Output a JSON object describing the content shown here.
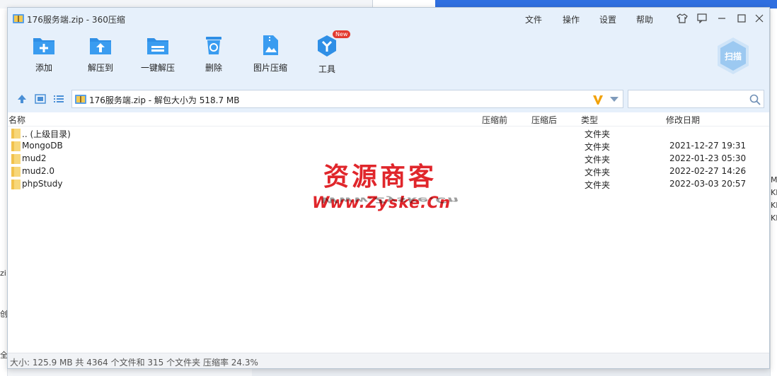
{
  "window": {
    "title": "176服务端.zip - 360压缩",
    "menu": [
      "文件",
      "操作",
      "设置",
      "帮助"
    ]
  },
  "toolbar": {
    "tools": [
      {
        "label": "添加",
        "icon": "add-icon"
      },
      {
        "label": "解压到",
        "icon": "extract-to-icon"
      },
      {
        "label": "一键解压",
        "icon": "one-click-extract-icon"
      },
      {
        "label": "删除",
        "icon": "delete-icon"
      },
      {
        "label": "图片压缩",
        "icon": "image-compress-icon"
      },
      {
        "label": "工具",
        "icon": "tools-icon"
      }
    ],
    "new_badge": "New",
    "scan_label": "扫描"
  },
  "nav": {
    "path": "176服务端.zip - 解包大小为 518.7 MB",
    "search_placeholder": ""
  },
  "list": {
    "columns": [
      "名称",
      "压缩前",
      "压缩后",
      "类型",
      "修改日期"
    ],
    "rows": [
      {
        "name": ".. (上级目录)",
        "type": "文件夹",
        "date": ""
      },
      {
        "name": "MongoDB",
        "type": "文件夹",
        "date": "2021-12-27 19:31"
      },
      {
        "name": "mud2",
        "type": "文件夹",
        "date": "2022-01-23 05:30"
      },
      {
        "name": "mud2.0",
        "type": "文件夹",
        "date": "2022-02-27 14:26"
      },
      {
        "name": "phpStudy",
        "type": "文件夹",
        "date": "2022-03-03 20:57"
      }
    ]
  },
  "watermark": {
    "cn": "资源商客",
    "en": "Www.Zyske.Cn"
  },
  "status": "大小: 125.9 MB 共 4364 个文件和 315 个文件夹 压缩率 24.3%",
  "background": {
    "right_fragments": [
      "MB",
      "KB",
      "KB",
      "KB"
    ],
    "left_fragments": [
      "zi",
      "创",
      "全"
    ]
  },
  "colors": {
    "accent": "#2f8fe6",
    "title_bg": "#e6f0fb",
    "watermark": "#e0262b"
  }
}
